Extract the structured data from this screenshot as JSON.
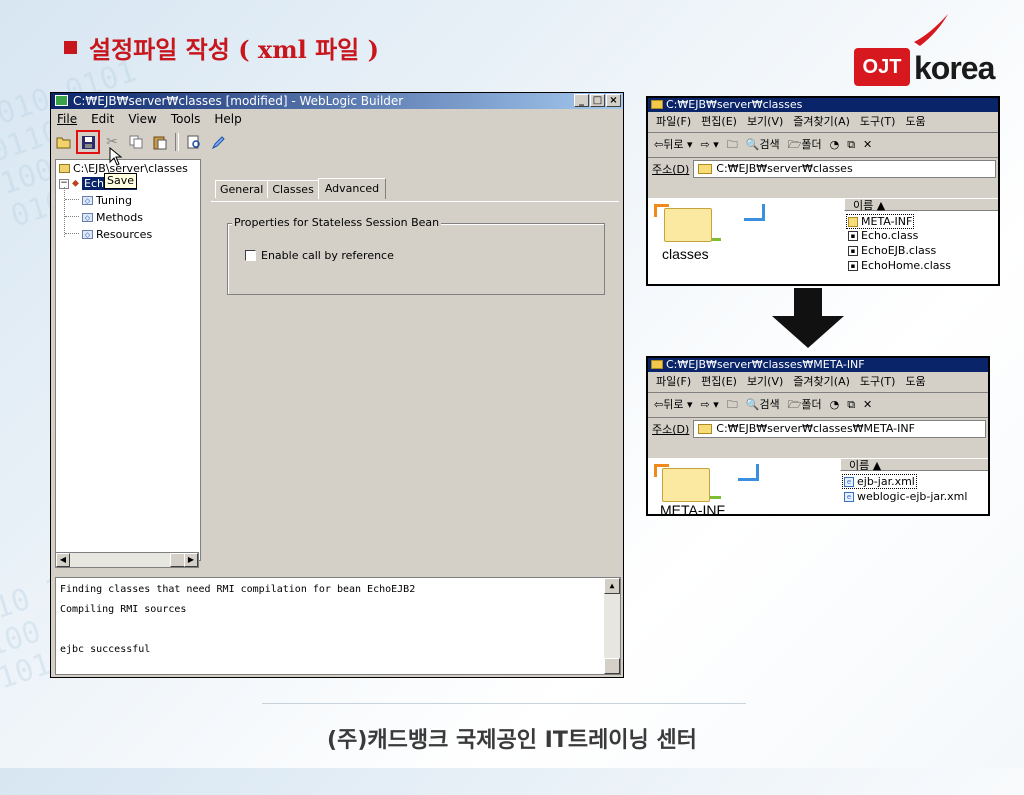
{
  "slide": {
    "title": "설정파일 작성 ( xml 파일 )",
    "footer": "(주)캐드뱅크 국제공인 IT트레이닝 센터",
    "logo": {
      "badge": "OJT",
      "word": "korea"
    },
    "accent_color": "#c8161d"
  },
  "weblogic": {
    "title": "C:₩EJB₩server₩classes [modified] - WebLogic Builder",
    "window_buttons": [
      "_",
      "□",
      "×"
    ],
    "menu": [
      "File",
      "Edit",
      "View",
      "Tools",
      "Help"
    ],
    "toolbar_icons": [
      "open-icon",
      "save-icon",
      "cut-icon",
      "copy-icon",
      "paste-icon",
      "find-icon",
      "edit-icon"
    ],
    "tooltip": "Save",
    "tree": {
      "root": "C:\\EJB\\server\\classes",
      "bean": "EchoEJB2",
      "children": [
        "Tuning",
        "Methods",
        "Resources"
      ]
    },
    "tabs": [
      "General",
      "Classes",
      "Advanced"
    ],
    "active_tab": "Advanced",
    "group_label": "Properties for Stateless Session Bean",
    "checkbox_label": "Enable call by reference",
    "checkbox_checked": false,
    "console": [
      "Finding classes that need RMI compilation for bean EchoEJB2",
      "Compiling RMI sources",
      "",
      "ejbc successful"
    ]
  },
  "explorer1": {
    "title": "C:₩EJB₩server₩classes",
    "menu": [
      "파일(F)",
      "편집(E)",
      "보기(V)",
      "즐겨찾기(A)",
      "도구(T)",
      "도움"
    ],
    "nav": [
      "⇦뒤로 ▾",
      "⇨ ▾",
      "검색",
      "폴더"
    ],
    "address_label": "주소(D)",
    "address": "C:₩EJB₩server₩classes",
    "folder_name": "classes",
    "column": "이름 ▲",
    "files": [
      "META-INF",
      "Echo.class",
      "EchoEJB.class",
      "EchoHome.class"
    ]
  },
  "explorer2": {
    "title": "C:₩EJB₩server₩classes₩META-INF",
    "menu": [
      "파일(F)",
      "편집(E)",
      "보기(V)",
      "즐겨찾기(A)",
      "도구(T)",
      "도움"
    ],
    "nav": [
      "⇦뒤로 ▾",
      "⇨ ▾",
      "검색",
      "폴더"
    ],
    "address_label": "주소(D)",
    "address": "C:₩EJB₩server₩classes₩META-INF",
    "folder_name": "META-INF",
    "column": "이름 ▲",
    "files": [
      "ejb-jar.xml",
      "weblogic-ejb-jar.xml"
    ]
  }
}
